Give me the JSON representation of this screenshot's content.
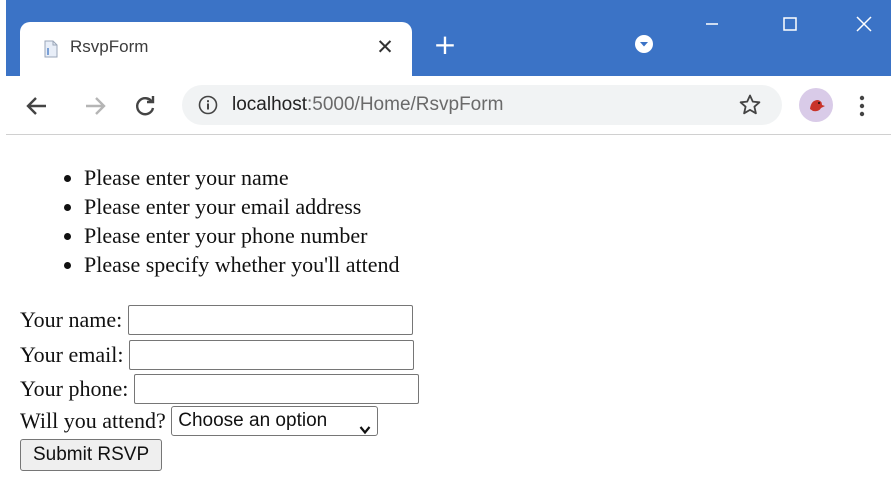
{
  "browser": {
    "tab_title": "RsvpForm",
    "tab_close_glyph": "✕",
    "new_tab_glyph": "+",
    "url_host": "localhost",
    "url_path": ":5000/Home/RsvpForm",
    "accent_color": "#3b73c6",
    "icons": {
      "favicon": "page-icon",
      "back": "back-arrow-icon",
      "forward": "forward-arrow-icon",
      "reload": "reload-icon",
      "info": "info-icon",
      "bookmark": "star-icon",
      "menu": "menu-dots-icon"
    }
  },
  "validation": {
    "errors": [
      "Please enter your name",
      "Please enter your email address",
      "Please enter your phone number",
      "Please specify whether you'll attend"
    ]
  },
  "form": {
    "name_label": "Your name:",
    "name_value": "",
    "email_label": "Your email:",
    "email_value": "",
    "phone_label": "Your phone:",
    "phone_value": "",
    "attend_label": "Will you attend?",
    "attend_selected": "Choose an option",
    "submit_label": "Submit RSVP"
  }
}
